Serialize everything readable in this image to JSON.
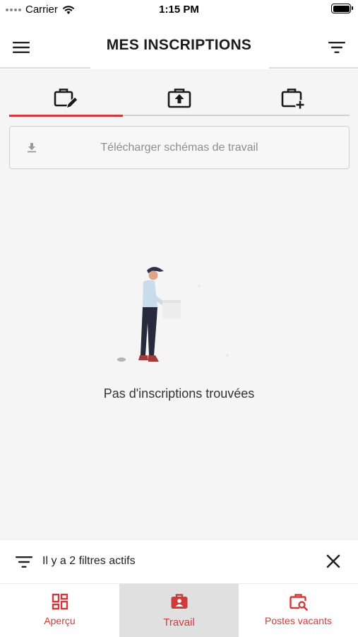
{
  "status_bar": {
    "carrier": "Carrier",
    "time": "1:15 PM"
  },
  "header": {
    "title": "MES INSCRIPTIONS",
    "menu_icon": "hamburger-menu-icon",
    "filter_icon": "filter-lines-icon"
  },
  "tabs": [
    {
      "icon": "briefcase-edit-icon",
      "active": true
    },
    {
      "icon": "briefcase-upload-icon",
      "active": false
    },
    {
      "icon": "briefcase-add-icon",
      "active": false
    }
  ],
  "download": {
    "label": "Télécharger schémas de travail",
    "icon": "download-icon"
  },
  "empty_state": {
    "message": "Pas d'inscriptions trouvées"
  },
  "filter_bar": {
    "text": "Il y a 2 filtres actifs",
    "icon": "filter-lines-icon",
    "close_icon": "close-icon"
  },
  "bottom_nav": [
    {
      "label": "Aperçu",
      "icon": "grid-dashboard-icon",
      "active": false
    },
    {
      "label": "Travail",
      "icon": "briefcase-person-icon",
      "active": true
    },
    {
      "label": "Postes vacants",
      "icon": "briefcase-search-icon",
      "active": false
    }
  ],
  "colors": {
    "accent": "#d13a3a",
    "background": "#f5f5f5",
    "surface": "#ffffff",
    "border": "#cfcfcf",
    "active_nav_bg": "#e0e0e0"
  }
}
